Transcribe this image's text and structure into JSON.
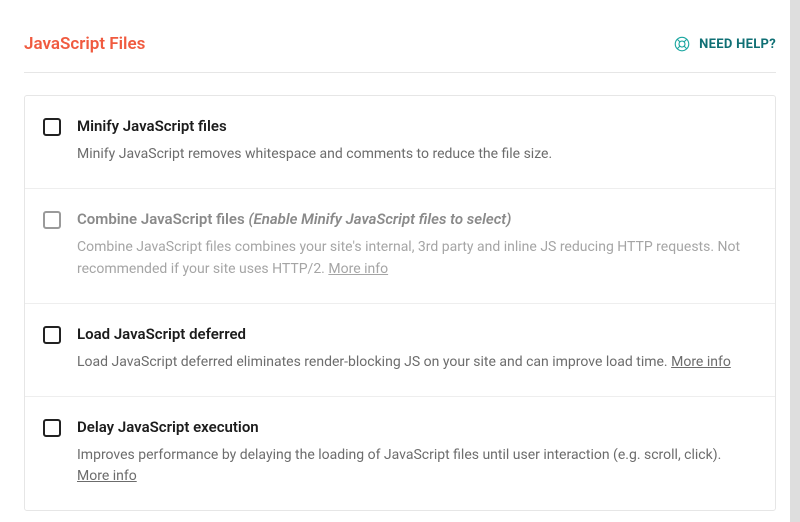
{
  "header": {
    "title": "JavaScript Files",
    "help_label": "NEED HELP?"
  },
  "options": [
    {
      "title": "Minify JavaScript files",
      "hint": "",
      "description": "Minify JavaScript removes whitespace and comments to reduce the file size.",
      "more_info": "",
      "disabled": false
    },
    {
      "title": "Combine JavaScript files",
      "hint": "(Enable Minify JavaScript files to select)",
      "description": "Combine JavaScript files combines your site's internal, 3rd party and inline JS reducing HTTP requests. Not recommended if your site uses HTTP/2.",
      "more_info": "More info",
      "disabled": true
    },
    {
      "title": "Load JavaScript deferred",
      "hint": "",
      "description": "Load JavaScript deferred eliminates render-blocking JS on your site and can improve load time.",
      "more_info": "More info",
      "disabled": false
    },
    {
      "title": "Delay JavaScript execution",
      "hint": "",
      "description": "Improves performance by delaying the loading of JavaScript files until user interaction (e.g. scroll, click).",
      "more_info": "More info",
      "disabled": false
    }
  ]
}
